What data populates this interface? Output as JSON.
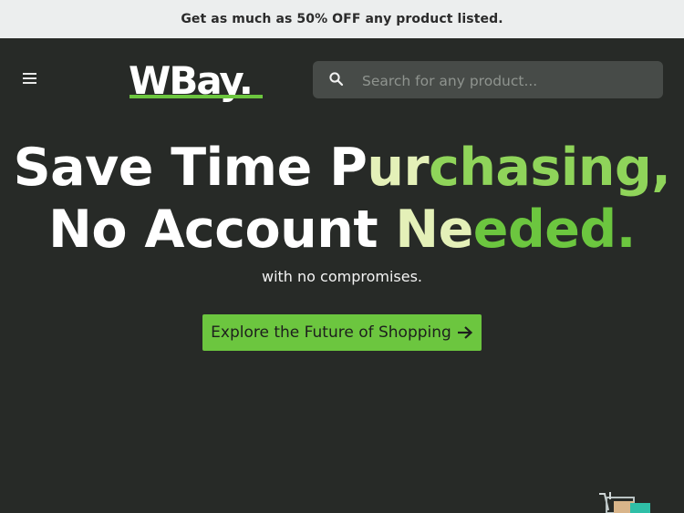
{
  "promo": {
    "text": "Get as much as 50% OFF any product listed."
  },
  "header": {
    "menu_icon": "hamburger-menu-icon",
    "logo": {
      "text": "WBay",
      "dot": "."
    },
    "search": {
      "placeholder": "Search for any product...",
      "value": "",
      "icon": "search-icon"
    }
  },
  "hero": {
    "headline_line1_a": "Save Time P",
    "headline_line1_b": "ur",
    "headline_line1_c": "chasing,",
    "headline_line2_a": "No Account ",
    "headline_line2_b": "Ne",
    "headline_line2_c": "eded.",
    "subline": "with no compromises.",
    "cta_label": "Explore the Future of Shopping",
    "cta_icon": "arrow-right-icon"
  },
  "colors": {
    "background": "#272a27",
    "promo_background": "#eceeee",
    "accent": "#6cc63f",
    "search_background": "#474b48"
  }
}
